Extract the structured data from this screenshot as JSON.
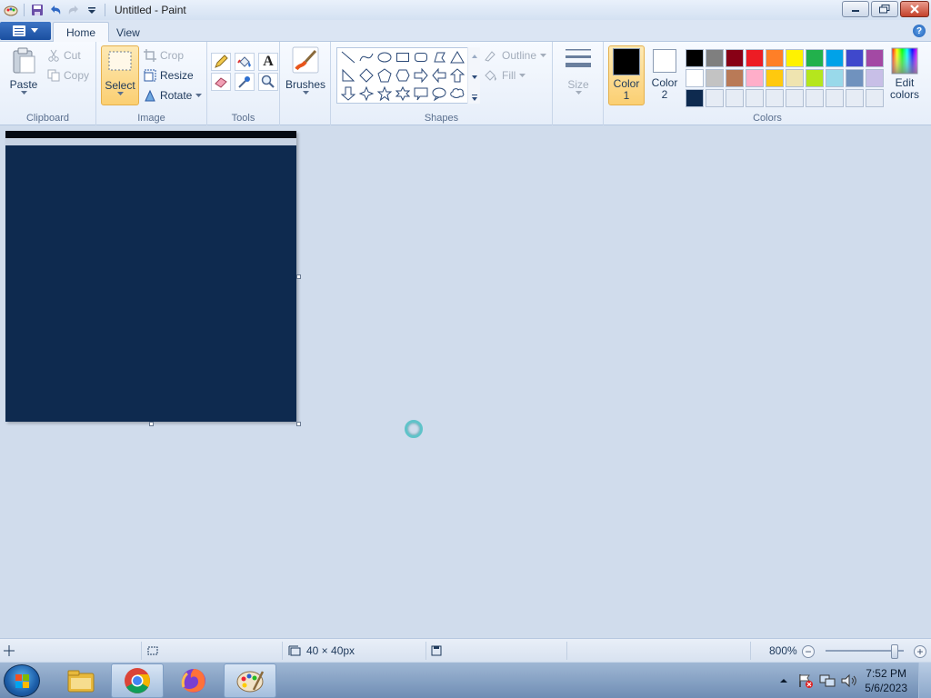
{
  "window": {
    "title": "Untitled - Paint",
    "controls": [
      "minimize-icon",
      "restore-icon",
      "close-icon"
    ]
  },
  "quick_access": {
    "icons": [
      "paint-app-icon",
      "save-icon",
      "undo-icon",
      "redo-icon",
      "customize-dropdown-icon"
    ]
  },
  "tabs": [
    {
      "label": "Home",
      "active": true
    },
    {
      "label": "View",
      "active": false
    }
  ],
  "ribbon": {
    "clipboard": {
      "label": "Clipboard",
      "paste": "Paste",
      "cut": "Cut",
      "copy": "Copy"
    },
    "image": {
      "label": "Image",
      "select": "Select",
      "crop": "Crop",
      "resize": "Resize",
      "rotate": "Rotate"
    },
    "tools": {
      "label": "Tools",
      "items": [
        "pencil-icon",
        "fill-icon",
        "text-icon",
        "eraser-icon",
        "color-picker-icon",
        "magnifier-icon"
      ],
      "text_glyph": "A"
    },
    "brushes": {
      "label": "Brushes"
    },
    "shapes": {
      "label": "Shapes",
      "outline": "Outline",
      "fill": "Fill"
    },
    "size": {
      "label": "Size"
    },
    "colors": {
      "label": "Colors",
      "color1_line1": "Color",
      "color1_line2": "1",
      "color2_line1": "Color",
      "color2_line2": "2",
      "edit_line1": "Edit",
      "edit_line2": "colors",
      "color1": "#000000",
      "color2": "#ffffff",
      "palette": [
        "#000000",
        "#7f7f7f",
        "#880015",
        "#ed1c24",
        "#ff7f27",
        "#fff200",
        "#22b14c",
        "#00a2e8",
        "#3f48cc",
        "#a349a4",
        "#ffffff",
        "#c3c3c3",
        "#b97a57",
        "#ffaec9",
        "#ffc90e",
        "#efe4b0",
        "#b5e61d",
        "#99d9ea",
        "#7092be",
        "#c8bfe7",
        "#0e2a4f",
        "",
        "",
        "",
        "",
        "",
        "",
        "",
        "",
        ""
      ]
    }
  },
  "canvas": {
    "fill_color": "#0e2a4f",
    "band_color": "#050a12"
  },
  "status": {
    "canvas_size": "40 × 40px",
    "zoom": "800%",
    "zoom_fraction": 0.88
  },
  "taskbar": {
    "apps": [
      "file-explorer-icon",
      "chrome-icon",
      "firefox-icon",
      "paint-icon"
    ],
    "active_app": "paint-icon",
    "time": "7:52 PM",
    "date": "5/6/2023"
  }
}
